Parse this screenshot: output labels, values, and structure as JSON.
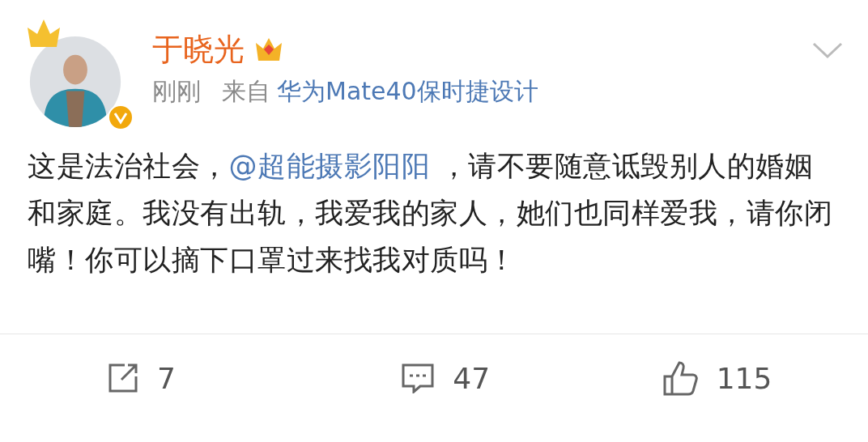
{
  "post": {
    "author": "于晓光",
    "time": "刚刚",
    "source_prefix": "来自",
    "source": "华为Mate40保时捷设计",
    "verified": true,
    "text_before": "这是法治社会，",
    "mention": "@超能摄影阳阳",
    "text_after": " ，请不要随意诋毁别人的婚姻和家庭。我没有出轨，我爱我的家人，她们也同样爱我，请你闭嘴！你可以摘下口罩过来找我对质吗！"
  },
  "actions": [
    {
      "kind": "repost",
      "count": "7"
    },
    {
      "kind": "comment",
      "count": "47"
    },
    {
      "kind": "like",
      "count": "115"
    }
  ]
}
